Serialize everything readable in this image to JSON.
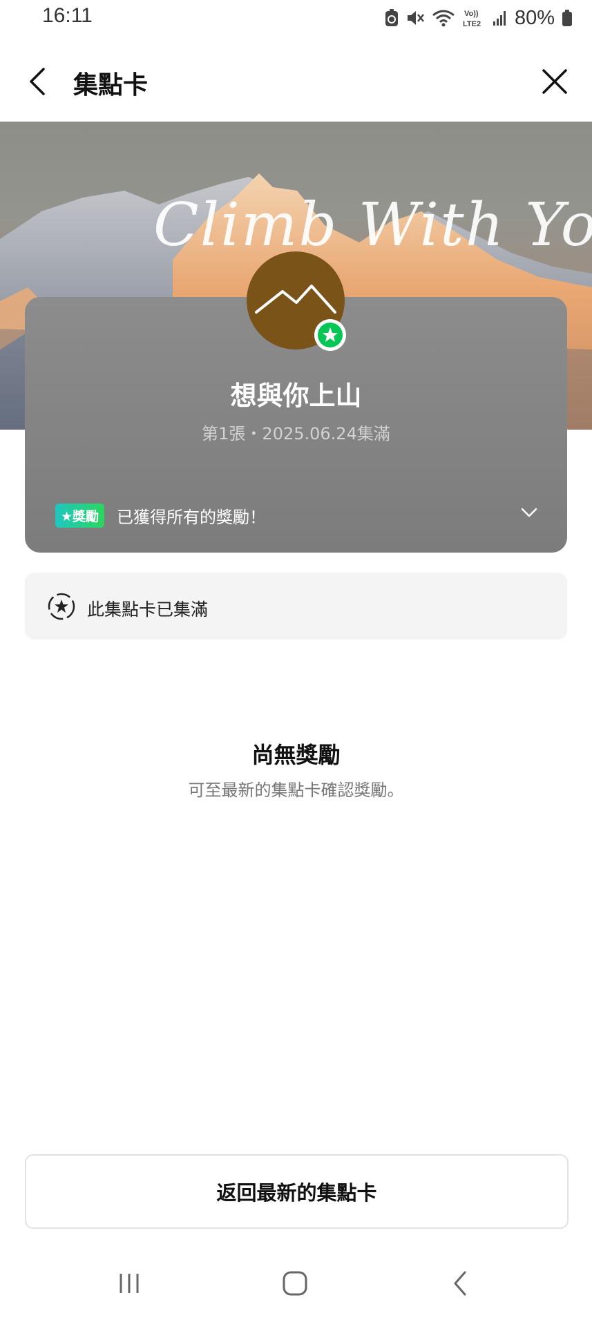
{
  "status_bar": {
    "time": "16:11",
    "battery_percent": "80%",
    "network_label": "LTE2",
    "volte_label": "Vo))"
  },
  "header": {
    "title": "集點卡"
  },
  "hero": {
    "script_text": "Climb With You"
  },
  "card": {
    "name": "想與你上山",
    "subtitle": "第1張・2025.06.24集滿",
    "reward_badge": "★獎勵",
    "reward_text": "已獲得所有的獎勵！",
    "avatar_color": "#7a5319",
    "badge_color": "#06c755"
  },
  "notice": {
    "text": "此集點卡已集滿"
  },
  "empty_state": {
    "title": "尚無獎勵",
    "description": "可至最新的集點卡確認獎勵。"
  },
  "bottom_button": {
    "label": "返回最新的集點卡"
  },
  "icons": {
    "back": "chevron-left-icon",
    "close": "close-icon",
    "notice": "stamp-star-icon",
    "reward_expand": "chevron-down-icon",
    "nav_recents": "recent-apps-icon",
    "nav_home": "home-icon",
    "nav_back": "back-icon"
  }
}
